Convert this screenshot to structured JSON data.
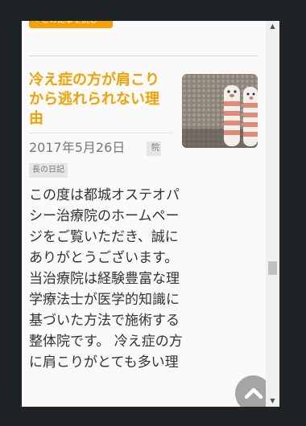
{
  "header": {
    "read_more_label": "› この記事を読む"
  },
  "article": {
    "title": "冷え症の方が肩こりから逃れられない理由",
    "date": "2017年5月26日",
    "category_tag_partial": "院",
    "category_tag": "長の日記",
    "excerpt": "この度は都城オステオパシー治療院のホームページをご覧いただき、誠にありがとうございます。当治療院は経験豊富な理学療法士が医学的知識に基づいた方法で施術する整体院です。 冷え症の方に肩こりがとても多い理"
  },
  "colors": {
    "accent": "#f5a100",
    "background": "#fafafa",
    "page_frame": "#1e2326",
    "to_top_button": "#a5a5a5"
  },
  "icons": {
    "scroll_to_top": "chevron-up-icon",
    "scroll_up": "scroll-up-arrow-icon",
    "scroll_down": "scroll-down-arrow-icon"
  }
}
